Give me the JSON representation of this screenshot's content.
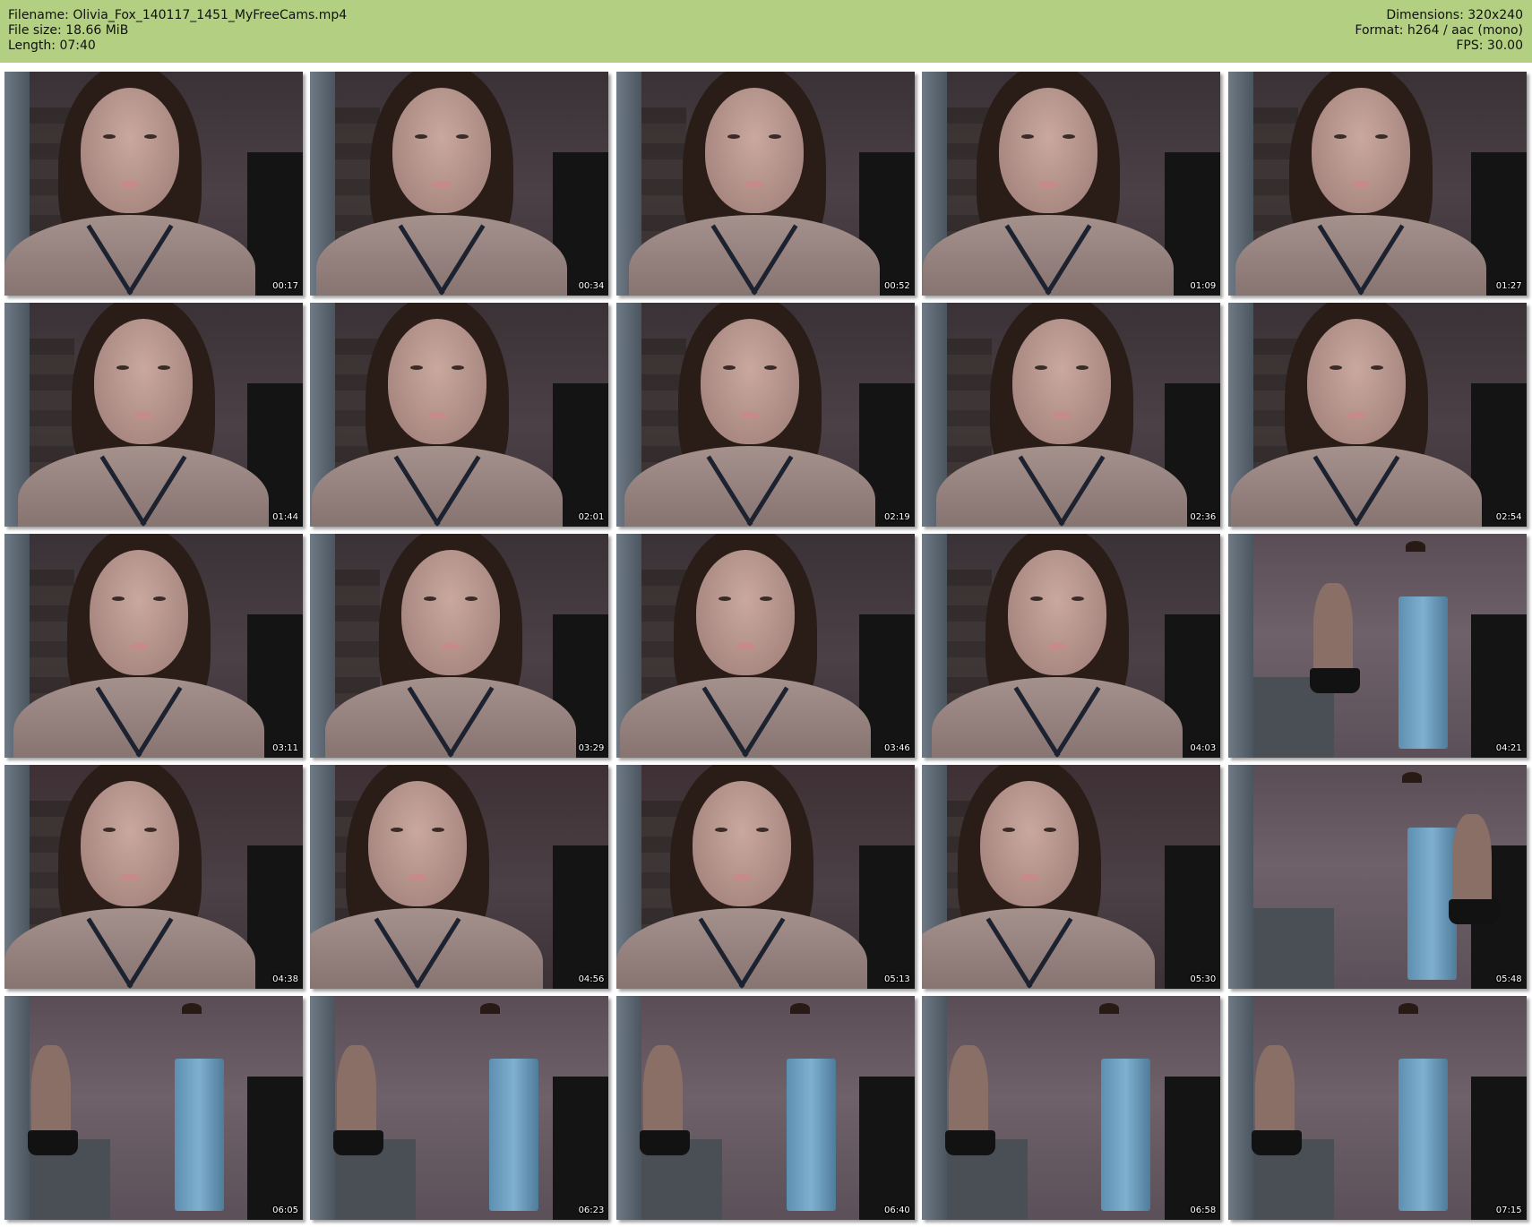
{
  "header": {
    "filename_label": "Filename:",
    "filename": "Olivia_Fox_140117_1451_MyFreeCams.mp4",
    "filesize_label": "File size:",
    "filesize": "18.66 MiB",
    "length_label": "Length:",
    "length": "07:40",
    "dimensions_label": "Dimensions:",
    "dimensions": "320x240",
    "format_label": "Format:",
    "format": "h264 / aac (mono)",
    "fps_label": "FPS:",
    "fps": "30.00"
  },
  "colors": {
    "header_bg": "#b3cf82",
    "timestamp_text": "#ffffff"
  },
  "thumbnails": [
    {
      "time": "00:17",
      "scene": "closeup"
    },
    {
      "time": "00:34",
      "scene": "closeup"
    },
    {
      "time": "00:52",
      "scene": "closeup"
    },
    {
      "time": "01:09",
      "scene": "closeup"
    },
    {
      "time": "01:27",
      "scene": "closeup"
    },
    {
      "time": "01:44",
      "scene": "closeup"
    },
    {
      "time": "02:01",
      "scene": "closeup"
    },
    {
      "time": "02:19",
      "scene": "closeup"
    },
    {
      "time": "02:36",
      "scene": "closeup"
    },
    {
      "time": "02:54",
      "scene": "closeup"
    },
    {
      "time": "03:11",
      "scene": "closeup"
    },
    {
      "time": "03:29",
      "scene": "closeup"
    },
    {
      "time": "03:46",
      "scene": "closeup"
    },
    {
      "time": "04:03",
      "scene": "closeup"
    },
    {
      "time": "04:21",
      "scene": "kitchen"
    },
    {
      "time": "04:38",
      "scene": "leaning"
    },
    {
      "time": "04:56",
      "scene": "leaning"
    },
    {
      "time": "05:13",
      "scene": "leaning"
    },
    {
      "time": "05:30",
      "scene": "leaning"
    },
    {
      "time": "05:48",
      "scene": "kitchen"
    },
    {
      "time": "06:05",
      "scene": "kitchen"
    },
    {
      "time": "06:23",
      "scene": "kitchen"
    },
    {
      "time": "06:40",
      "scene": "kitchen"
    },
    {
      "time": "06:58",
      "scene": "kitchen"
    },
    {
      "time": "07:15",
      "scene": "kitchen"
    }
  ]
}
